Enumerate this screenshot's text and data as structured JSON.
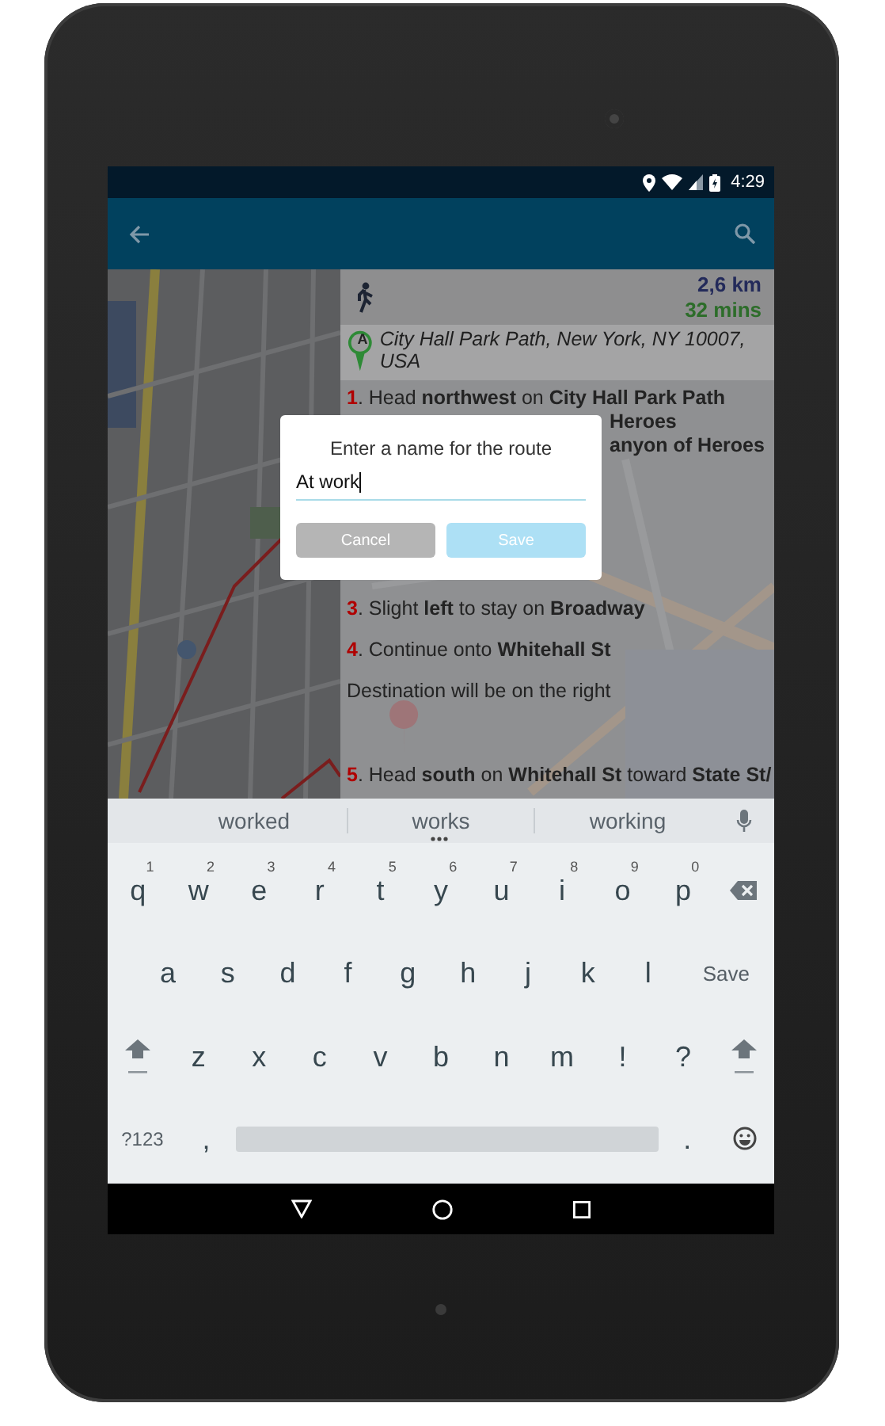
{
  "status_bar": {
    "time": "4:29"
  },
  "route": {
    "distance": "2,6 km",
    "duration": "32 mins",
    "start_marker": "A",
    "start_address": "City Hall Park Path, New York, NY 10007, USA"
  },
  "steps": [
    {
      "kind": "step",
      "number": "1",
      "text": ". Head **northwest** on **City Hall Park Path**"
    },
    {
      "kind": "fragment",
      "text": "**Heroes**"
    },
    {
      "kind": "fragment",
      "text": "**anyon of Heroes**"
    },
    {
      "kind": "step",
      "number": "3",
      "text": ". Slight **left** to stay on **Broadway**"
    },
    {
      "kind": "step",
      "number": "4",
      "text": ". Continue onto **Whitehall St**"
    },
    {
      "kind": "note",
      "text": "Destination will be on the right"
    },
    {
      "kind": "step",
      "number": "5",
      "text": ". Head **south** on **Whitehall St** toward **State St/**"
    }
  ],
  "dialog": {
    "title": "Enter a name for the route",
    "value": "At work",
    "buttons": [
      "Cancel",
      "Save"
    ]
  },
  "suggestions": [
    "worked",
    "works",
    "working"
  ],
  "keyboard_rows": [
    [
      {
        "kind": "char",
        "label": "q",
        "hint": "1"
      },
      {
        "kind": "char",
        "label": "w",
        "hint": "2"
      },
      {
        "kind": "char",
        "label": "e",
        "hint": "3"
      },
      {
        "kind": "char",
        "label": "r",
        "hint": "4"
      },
      {
        "kind": "char",
        "label": "t",
        "hint": "5"
      },
      {
        "kind": "char",
        "label": "y",
        "hint": "6"
      },
      {
        "kind": "char",
        "label": "u",
        "hint": "7"
      },
      {
        "kind": "char",
        "label": "i",
        "hint": "8"
      },
      {
        "kind": "char",
        "label": "o",
        "hint": "9"
      },
      {
        "kind": "char",
        "label": "p",
        "hint": "0"
      },
      {
        "kind": "backspace"
      }
    ],
    [
      {
        "kind": "char",
        "label": "a"
      },
      {
        "kind": "char",
        "label": "s"
      },
      {
        "kind": "char",
        "label": "d"
      },
      {
        "kind": "char",
        "label": "f"
      },
      {
        "kind": "char",
        "label": "g"
      },
      {
        "kind": "char",
        "label": "h"
      },
      {
        "kind": "char",
        "label": "j"
      },
      {
        "kind": "char",
        "label": "k"
      },
      {
        "kind": "char",
        "label": "l"
      },
      {
        "kind": "action",
        "label": "Save"
      }
    ],
    [
      {
        "kind": "shift"
      },
      {
        "kind": "char",
        "label": "z"
      },
      {
        "kind": "char",
        "label": "x"
      },
      {
        "kind": "char",
        "label": "c"
      },
      {
        "kind": "char",
        "label": "v"
      },
      {
        "kind": "char",
        "label": "b"
      },
      {
        "kind": "char",
        "label": "n"
      },
      {
        "kind": "char",
        "label": "m"
      },
      {
        "kind": "char",
        "label": "!"
      },
      {
        "kind": "char",
        "label": "?"
      },
      {
        "kind": "shift"
      }
    ],
    [
      {
        "kind": "action",
        "label": "?123"
      },
      {
        "kind": "char",
        "label": ","
      },
      {
        "kind": "space"
      },
      {
        "kind": "char",
        "label": "."
      },
      {
        "kind": "emoji"
      }
    ]
  ]
}
